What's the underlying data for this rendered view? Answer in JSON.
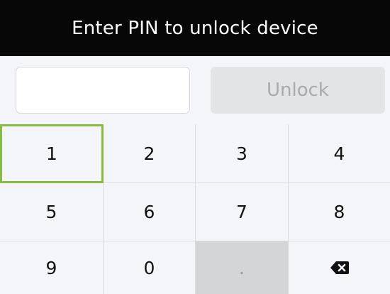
{
  "header": {
    "title": "Enter PIN to unlock device"
  },
  "pin_entry": {
    "value": "",
    "placeholder": "",
    "unlock_label": "Unlock"
  },
  "keypad": {
    "keys": [
      "1",
      "2",
      "3",
      "4",
      "5",
      "6",
      "7",
      "8",
      "9",
      "0",
      "."
    ],
    "focused_key": "1",
    "disabled_key": ".",
    "backspace_icon": "backspace-icon"
  },
  "colors": {
    "header_bg": "#070707",
    "focus_accent": "#86bd3a",
    "unlock_disabled_bg": "#e3e4e8"
  }
}
